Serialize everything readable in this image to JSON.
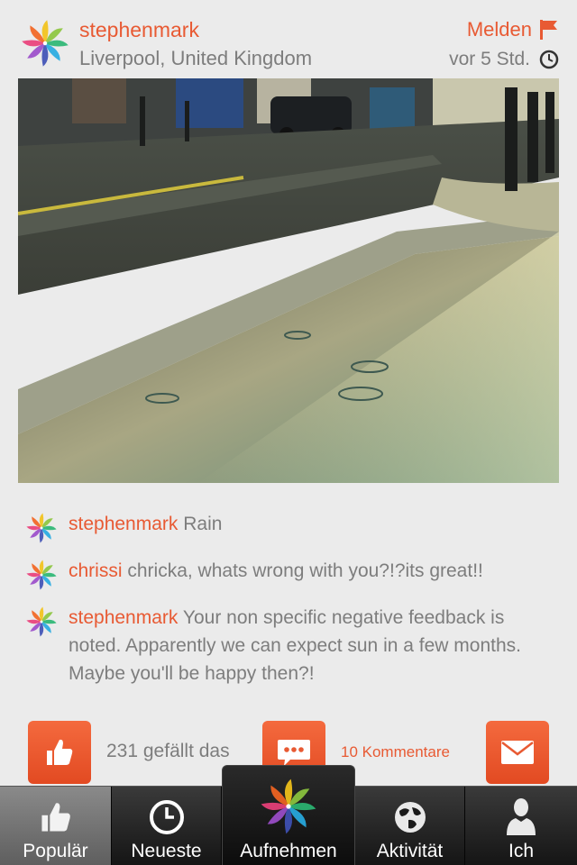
{
  "post": {
    "username": "stephenmark",
    "location": "Liverpool, United Kingdom",
    "report_label": "Melden",
    "timestamp": "vor 5 Std."
  },
  "comments": [
    {
      "user": "stephenmark",
      "text": "Rain"
    },
    {
      "user": "chrissi",
      "text": "chricka, whats wrong with you?!?its great!!"
    },
    {
      "user": "stephenmark",
      "text": "Your non specific negative feedback is noted. Apparently we can expect sun in a few months. Maybe you'll be happy then?!"
    }
  ],
  "actions": {
    "likes_label": "231 gefällt das",
    "comments_label": "10 Kommentare"
  },
  "tabs": {
    "popular": "Populär",
    "newest": "Neueste",
    "capture": "Aufnehmen",
    "activity": "Aktivität",
    "me": "Ich"
  },
  "colors": {
    "accent": "#e85a33",
    "text_gray": "#7d7d7d",
    "background": "#ebebeb"
  },
  "icons": [
    "pinwheel-logo-icon",
    "flag-icon",
    "clock-icon",
    "thumbs-up-icon",
    "speech-bubble-icon",
    "envelope-icon",
    "globe-icon",
    "person-icon"
  ]
}
